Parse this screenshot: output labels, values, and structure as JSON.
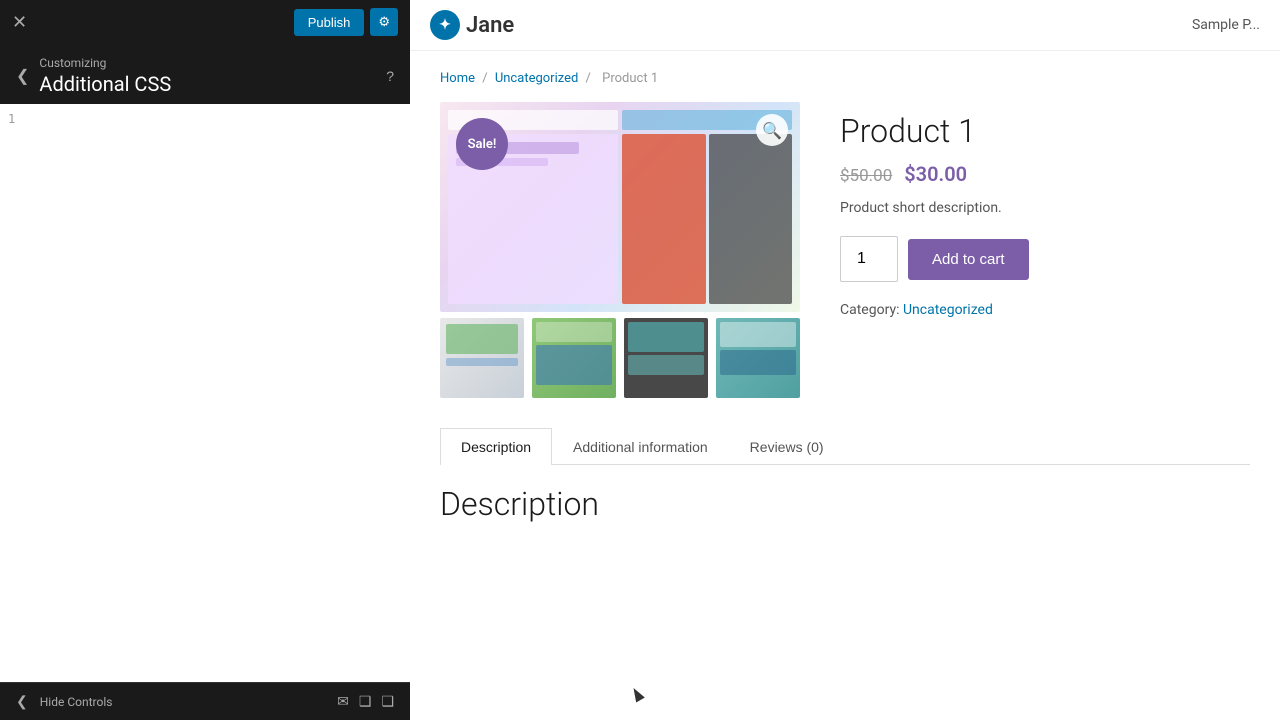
{
  "left_panel": {
    "close_label": "✕",
    "publish_label": "Publish",
    "gear_label": "⚙",
    "customizing_label": "Customizing",
    "title": "Additional CSS",
    "back_arrow": "❮",
    "help_icon": "?",
    "line_number": "1",
    "footer": {
      "hide_label": "Hide Controls",
      "arrow": "❮",
      "icon1": "✉",
      "icon2": "❑",
      "icon3": "❑"
    }
  },
  "site_header": {
    "logo_icon": "✦",
    "logo_text": "Jane",
    "nav_link": "Sample P..."
  },
  "breadcrumb": {
    "home": "Home",
    "sep1": "/",
    "uncategorized": "Uncategorized",
    "sep2": "/",
    "product": "Product 1"
  },
  "product": {
    "sale_badge": "Sale!",
    "title": "Product 1",
    "original_price": "$50.00",
    "sale_price": "$30.00",
    "short_description": "Product short description.",
    "quantity": "1",
    "add_to_cart_label": "Add to cart",
    "category_label": "Category:",
    "category_link": "Uncategorized"
  },
  "tabs": {
    "description": "Description",
    "additional_info": "Additional information",
    "reviews": "Reviews (0)"
  },
  "description_section": {
    "title": "Description"
  }
}
